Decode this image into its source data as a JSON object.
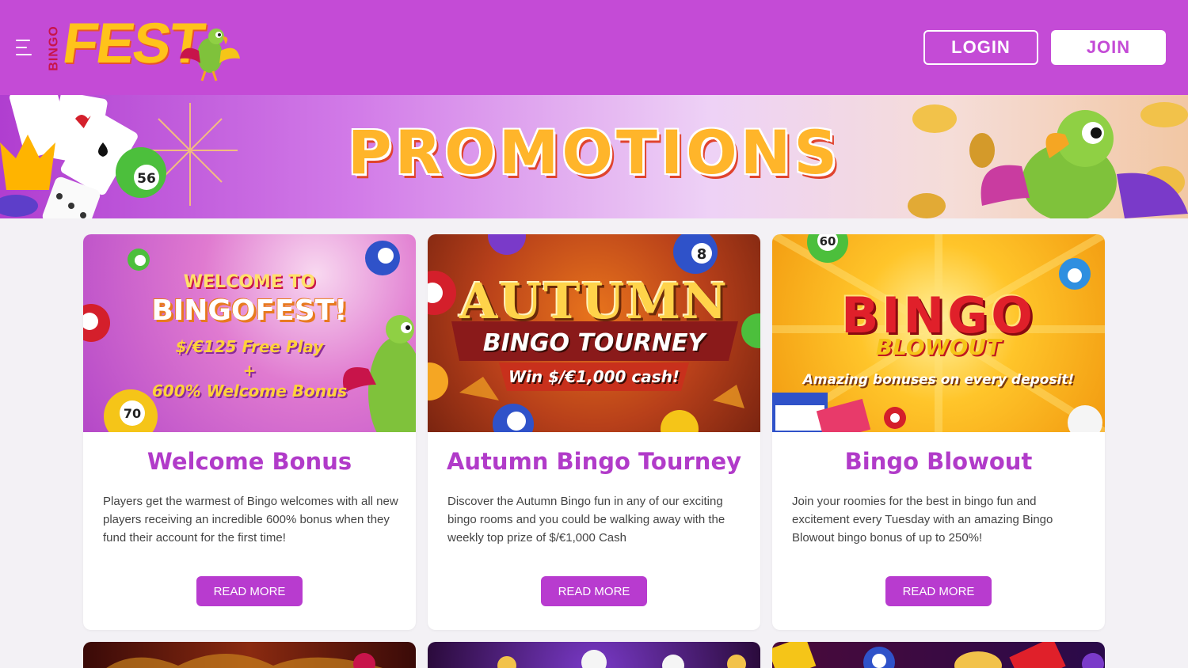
{
  "header": {
    "logo_small": "BINGO",
    "logo_main": "FEST",
    "login_label": "LOGIN",
    "join_label": "JOIN"
  },
  "banner": {
    "title": "PROMOTIONS"
  },
  "cards": [
    {
      "image_text": {
        "line1": "WELCOME TO",
        "line2": "BINGOFEST!",
        "line3": "$/€125 Free Play",
        "line4": "+",
        "line5": "600% Welcome Bonus"
      },
      "title": "Welcome Bonus",
      "description": "Players get the warmest of Bingo welcomes with all new players receiving an incredible 600% bonus when they fund their account for the first time!",
      "button": "READ MORE"
    },
    {
      "image_text": {
        "line1": "AUTUMN",
        "line2": "BINGO TOURNEY",
        "line3": "Win $/€1,000 cash!"
      },
      "title": "Autumn Bingo Tourney",
      "description": "Discover the Autumn Bingo fun in any of our exciting bingo rooms and you could be walking away with the weekly top prize of $/€1,000 Cash",
      "button": "READ MORE"
    },
    {
      "image_text": {
        "line1": "BINGO",
        "line2": "BLOWOUT",
        "line3": "Amazing bonuses on every deposit!"
      },
      "title": "Bingo Blowout",
      "description": "Join your roomies for the best in bingo fun and excitement every Tuesday with an amazing Bingo Blowout bingo bonus of up to 250%!",
      "button": "READ MORE"
    }
  ],
  "colors": {
    "header_bg": "#c44bd6",
    "accent": "#b83bcf",
    "card_title": "#b13bc9",
    "page_bg": "#f3f1f5"
  }
}
